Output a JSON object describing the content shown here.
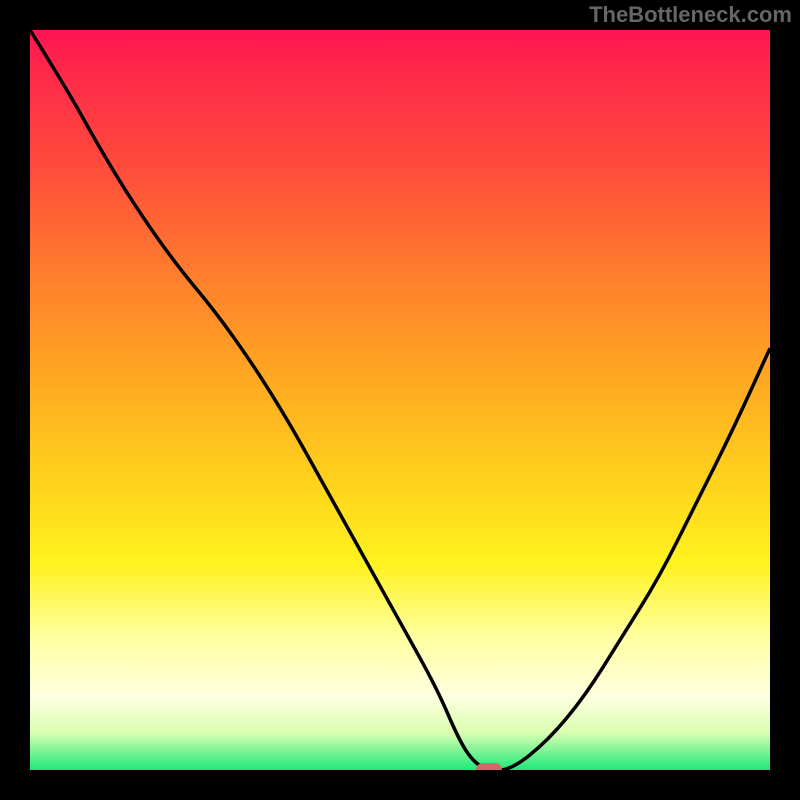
{
  "watermark": "TheBottleneck.com",
  "colors": {
    "frame": "#000000",
    "gradient_top": "#ff1452",
    "gradient_mid": "#ffe81e",
    "gradient_bottom": "#1ee87a",
    "curve": "#000000",
    "pip": "#d06a6a",
    "watermark_text": "#666666"
  },
  "chart_data": {
    "type": "line",
    "title": "",
    "xlabel": "",
    "ylabel": "",
    "xlim": [
      0,
      100
    ],
    "ylim": [
      0,
      100
    ],
    "series": [
      {
        "name": "bottleneck-curve",
        "x": [
          0,
          5,
          10,
          15,
          20,
          25,
          30,
          35,
          40,
          45,
          50,
          55,
          58,
          60,
          62,
          65,
          70,
          75,
          80,
          85,
          90,
          95,
          100
        ],
        "values": [
          100,
          92,
          83,
          75,
          68,
          62,
          55,
          47,
          38,
          29,
          20,
          11,
          4,
          1,
          0,
          0,
          4,
          10,
          18,
          26,
          36,
          46,
          57
        ]
      }
    ],
    "marker": {
      "x": 62,
      "y": 0,
      "size_pct": 3.5
    }
  }
}
